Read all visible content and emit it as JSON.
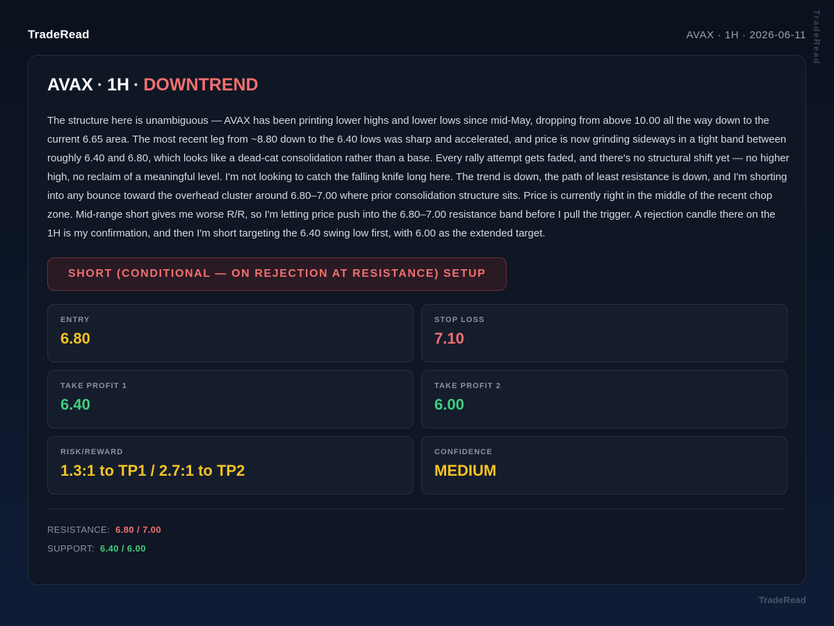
{
  "header": {
    "brand": "TradeRead",
    "meta": "AVAX · 1H · 2026-06-11",
    "side_watermark": "TradeRead"
  },
  "card": {
    "symbol": "AVAX",
    "timeframe": "1H",
    "separator": "·",
    "trend": "DOWNTREND",
    "analysis": "The structure here is unambiguous — AVAX has been printing lower highs and lower lows since mid-May, dropping from above 10.00 all the way down to the current 6.65 area. The most recent leg from ~8.80 down to the 6.40 lows was sharp and accelerated, and price is now grinding sideways in a tight band between roughly 6.40 and 6.80, which looks like a dead-cat consolidation rather than a base. Every rally attempt gets faded, and there's no structural shift yet — no higher high, no reclaim of a meaningful level. I'm not looking to catch the falling knife long here. The trend is down, the path of least resistance is down, and I'm shorting into any bounce toward the overhead cluster around 6.80–7.00 where prior consolidation structure sits. Price is currently right in the middle of the recent chop zone. Mid-range short gives me worse R/R, so I'm letting price push into the 6.80–7.00 resistance band before I pull the trigger. A rejection candle there on the 1H is my confirmation, and then I'm short targeting the 6.40 swing low first, with 6.00 as the extended target.",
    "setup_label": "SHORT (CONDITIONAL — ON REJECTION AT RESISTANCE) SETUP",
    "metrics": {
      "entry": {
        "label": "ENTRY",
        "value": "6.80"
      },
      "stop_loss": {
        "label": "STOP LOSS",
        "value": "7.10"
      },
      "tp1": {
        "label": "TAKE PROFIT 1",
        "value": "6.40"
      },
      "tp2": {
        "label": "TAKE PROFIT 2",
        "value": "6.00"
      },
      "rr": {
        "label": "RISK/REWARD",
        "value": "1.3:1 to TP1 / 2.7:1 to TP2"
      },
      "confidence": {
        "label": "CONFIDENCE",
        "value": "MEDIUM"
      }
    },
    "levels": {
      "resistance_label": "RESISTANCE:",
      "resistance_value": "6.80 / 7.00",
      "support_label": "SUPPORT:",
      "support_value": "6.40 / 6.00"
    }
  },
  "footer": {
    "brand": "TradeRead"
  },
  "colors": {
    "accent_red": "#f2706f",
    "accent_yellow": "#f5c324",
    "accent_green": "#3fcf7d"
  }
}
